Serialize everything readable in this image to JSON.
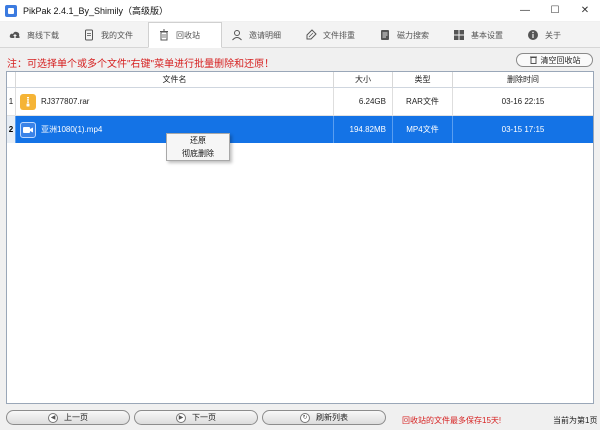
{
  "window": {
    "title": "PikPak 2.4.1_By_Shimily（高级版）",
    "minimize": "—",
    "maximize": "☐",
    "close": "✕"
  },
  "tabs": [
    {
      "label": "离线下载",
      "icon": "cloud-upload-icon"
    },
    {
      "label": "我的文件",
      "icon": "file-icon"
    },
    {
      "label": "回收站",
      "icon": "trash-icon",
      "active": true
    },
    {
      "label": "邀请明细",
      "icon": "user-icon"
    },
    {
      "label": "文件排重",
      "icon": "brush-icon"
    },
    {
      "label": "磁力搜索",
      "icon": "document-icon"
    },
    {
      "label": "基本设置",
      "icon": "grid-icon"
    },
    {
      "label": "关于",
      "icon": "info-icon"
    }
  ],
  "notice": "注：可选择单个或多个文件\"右键\"菜单进行批量删除和还原！",
  "clear_button": "清空回收站",
  "table": {
    "columns": [
      "文件名",
      "大小",
      "类型",
      "删除时间"
    ],
    "rows": [
      {
        "num": "1",
        "name": "RJ377807.rar",
        "size": "6.24GB",
        "type": "RAR文件",
        "time": "03-16 22:15",
        "icon": "archive-icon",
        "selected": false
      },
      {
        "num": "2",
        "name": "亚洲1080(1).mp4",
        "size": "194.82MB",
        "type": "MP4文件",
        "time": "03-15 17:15",
        "icon": "video-icon",
        "selected": true
      }
    ]
  },
  "context_menu": [
    "还原",
    "彻底删除"
  ],
  "bottom": {
    "prev": "上一页",
    "next": "下一页",
    "refresh": "刷新列表",
    "warning": "回收站的文件最多保存15天!",
    "page_info": "当前为第1页"
  },
  "colors": {
    "selection": "#1473e6",
    "warning": "#d62020",
    "rar_icon": "#f5b436",
    "mp4_icon": "#3a83e8"
  }
}
